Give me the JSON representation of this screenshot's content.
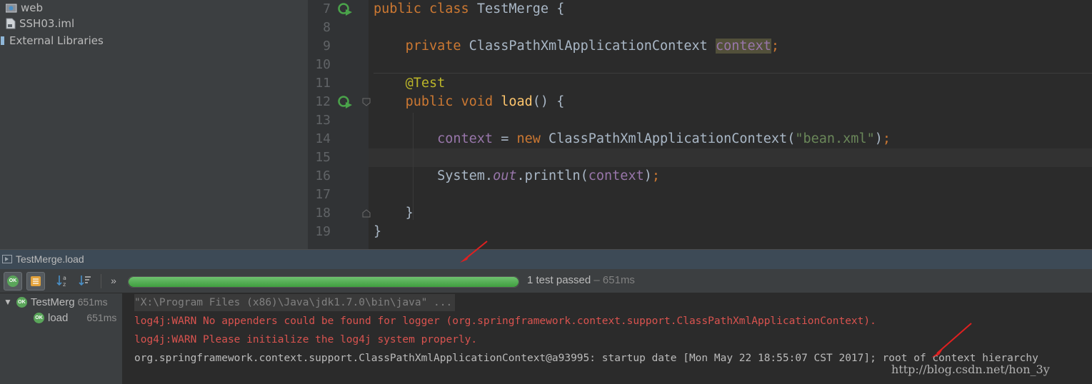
{
  "project_tree": {
    "items": [
      {
        "label": "web",
        "icon": "folder-icon"
      },
      {
        "label": "SSH03.iml",
        "icon": "module-file-icon"
      },
      {
        "label": "External Libraries",
        "icon": "library-icon"
      }
    ]
  },
  "editor": {
    "line_numbers": [
      "7",
      "8",
      "9",
      "10",
      "11",
      "12",
      "13",
      "14",
      "15",
      "16",
      "17",
      "18",
      "19"
    ],
    "code": {
      "l7": {
        "kw1": "public",
        "kw2": "class",
        "name": "TestMerge",
        "brace": "{"
      },
      "l9": {
        "kw": "private",
        "type": "ClassPathXmlApplicationContext",
        "field": "context",
        "semi": ";"
      },
      "l11": {
        "annotation": "@Test"
      },
      "l12": {
        "kw1": "public",
        "kw2": "void",
        "method": "load",
        "rest": "() {"
      },
      "l14": {
        "field": "context",
        "eq": " = ",
        "kw": "new",
        "call": " ClassPathXmlApplicationContext(",
        "str": "\"bean.xml\"",
        "close": ")",
        "semi": ";"
      },
      "l16": {
        "obj": "System.",
        "static": "out",
        "call": ".println(",
        "arg": "context",
        "close": ")",
        "semi": ";"
      },
      "l18": {
        "brace": "}"
      },
      "l19": {
        "brace": "}"
      }
    }
  },
  "run_panel": {
    "title": "TestMerge.load",
    "progress": 1.0,
    "status": "1 test passed",
    "status_time": " – 651ms",
    "tests": [
      {
        "name": "TestMerg",
        "time": "651ms",
        "status": "OK"
      },
      {
        "name": "load",
        "time": "651ms",
        "status": "OK"
      }
    ],
    "console": [
      {
        "text": "\"X:\\Program Files (x86)\\Java\\jdk1.7.0\\bin\\java\" ...",
        "color": "#808080"
      },
      {
        "text": "log4j:WARN No appenders could be found for logger (org.springframework.context.support.ClassPathXmlApplicationContext).",
        "color": "#d9534f"
      },
      {
        "text": "log4j:WARN Please initialize the log4j system properly.",
        "color": "#d9534f"
      },
      {
        "text": "org.springframework.context.support.ClassPathXmlApplicationContext@a93995: startup date [Mon May 22 18:55:07 CST 2017]; root of context hierarchy",
        "color": "#bbbbbb"
      }
    ]
  },
  "watermark": "http://blog.csdn.net/hon_3y",
  "colors": {
    "accent_green": "#5aa55a",
    "error_red": "#d9534f",
    "arrow_red": "#e02020"
  }
}
